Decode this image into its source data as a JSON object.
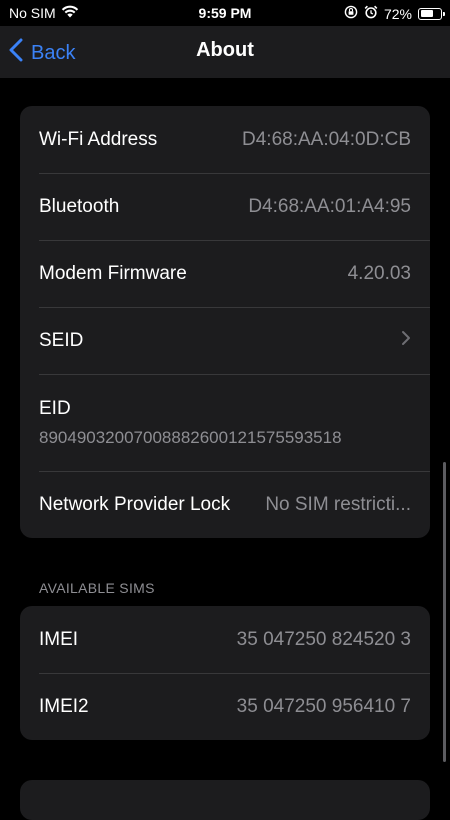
{
  "status_bar": {
    "carrier": "No SIM",
    "time": "9:59 PM",
    "battery_percent": "72%",
    "battery_level": 0.72,
    "icons": [
      "wifi-icon",
      "orientation-lock-icon",
      "alarm-icon",
      "battery-icon"
    ]
  },
  "nav": {
    "back_label": "Back",
    "title": "About"
  },
  "group_network": {
    "rows": [
      {
        "label": "Wi-Fi Address",
        "value": "D4:68:AA:04:0D:CB"
      },
      {
        "label": "Bluetooth",
        "value": "D4:68:AA:01:A4:95"
      },
      {
        "label": "Modem Firmware",
        "value": "4.20.03"
      },
      {
        "label": "SEID",
        "value": ""
      },
      {
        "label": "EID",
        "value": "89049032007008882600121575593518"
      },
      {
        "label": "Network Provider Lock",
        "value": "No SIM restricti..."
      }
    ]
  },
  "sims": {
    "header": "AVAILABLE SIMS",
    "rows": [
      {
        "label": "IMEI",
        "value": "35 047250 824520 3"
      },
      {
        "label": "IMEI2",
        "value": "35 047250 956410 7"
      }
    ]
  },
  "colors": {
    "accent": "#3b82f6",
    "background": "#000000",
    "cell": "#1c1c1e",
    "secondary_text": "#8e8e93"
  }
}
